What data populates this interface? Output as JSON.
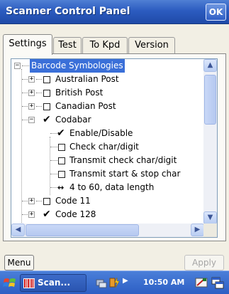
{
  "window": {
    "title": "Scanner Control Panel",
    "ok_label": "OK"
  },
  "tabs": [
    {
      "label": "Settings",
      "active": true
    },
    {
      "label": "Test",
      "active": false
    },
    {
      "label": "To Kpd",
      "active": false
    },
    {
      "label": "Version",
      "active": false
    }
  ],
  "tree": {
    "root": {
      "label": "Barcode Symbologies",
      "expanded": true,
      "selected": true
    },
    "items": [
      {
        "label": "Australian Post",
        "checked": false,
        "expanded": false
      },
      {
        "label": "British Post",
        "checked": false,
        "expanded": false
      },
      {
        "label": "Canadian Post",
        "checked": false,
        "expanded": false
      },
      {
        "label": "Codabar",
        "checked": true,
        "expanded": true,
        "children": [
          {
            "label": "Enable/Disable",
            "checked": true
          },
          {
            "label": "Check char/digit",
            "checked": false
          },
          {
            "label": "Transmit check char/digit",
            "checked": false
          },
          {
            "label": "Transmit start & stop char",
            "checked": false
          },
          {
            "label": "4 to 60, data length",
            "type": "range"
          }
        ]
      },
      {
        "label": "Code 11",
        "checked": false,
        "expanded": false
      },
      {
        "label": "Code 128",
        "checked": true,
        "expanded": false
      }
    ]
  },
  "buttons": {
    "menu_label": "Menu",
    "apply_label": "Apply"
  },
  "taskbar": {
    "task_label": "Scan...",
    "clock": "10:50 AM"
  },
  "colors": {
    "title_bar": "#2c5cc0",
    "selection": "#3a6fd8",
    "window_bg": "#f2efe4"
  }
}
